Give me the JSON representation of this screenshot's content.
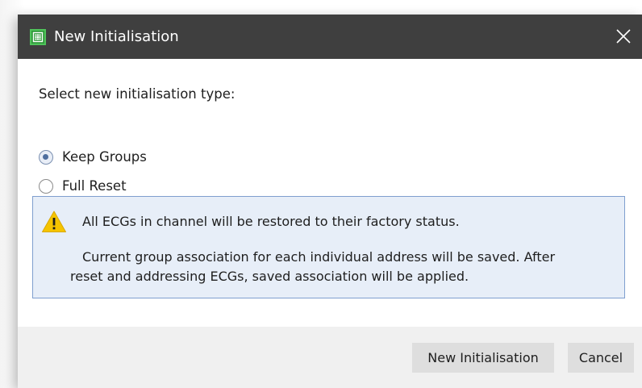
{
  "window": {
    "title": "New Initialisation",
    "app_icon": "grid-app-icon",
    "close_icon": "close-icon"
  },
  "dialog": {
    "prompt": "Select new initialisation type:",
    "options": [
      {
        "label": "Keep Groups",
        "selected": true
      },
      {
        "label": "Full Reset",
        "selected": false
      }
    ],
    "info": {
      "icon": "warning-icon",
      "line1": "All ECGs in channel will be restored to their factory status.",
      "line2a": "Current group association for each individual address will be saved. After",
      "line2b": "reset and addressing ECGs, saved association will be applied."
    }
  },
  "footer": {
    "primary_label": "New Initialisation",
    "cancel_label": "Cancel"
  },
  "colors": {
    "titlebar": "#3f3f3f",
    "info_bg": "#e7eef8",
    "info_border": "#7f9fcf",
    "warning": "#f5c400",
    "button_bg": "#dedede",
    "footer_bg": "#f0f0f0"
  }
}
